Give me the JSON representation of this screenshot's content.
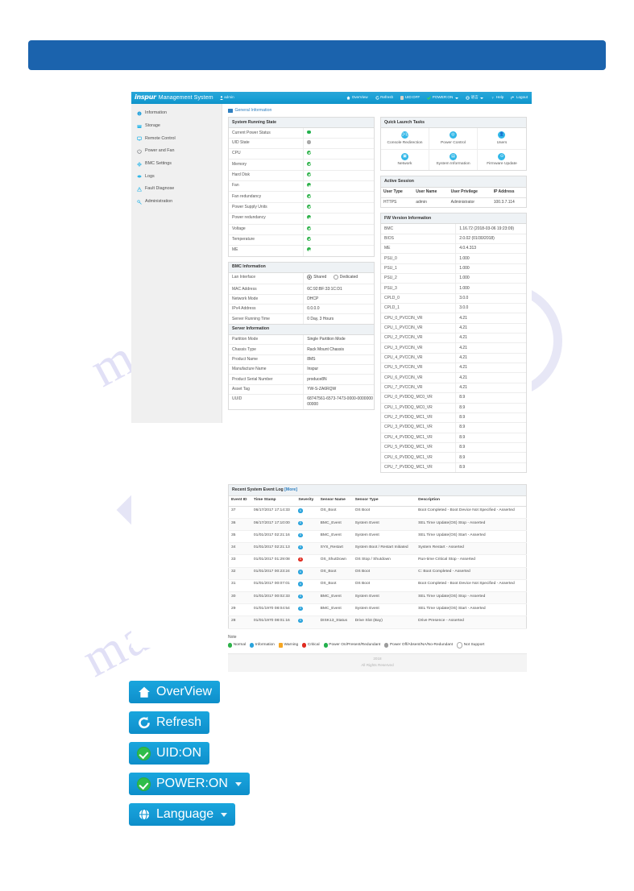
{
  "banner": {
    "text": ""
  },
  "watermark": {
    "line1": "manualslib",
    "line2": "com",
    "line3": "manualslib"
  },
  "app": {
    "brand_logo": "inspur",
    "brand_title": "Management System",
    "user": "admin",
    "topnav": [
      {
        "label": "OverView",
        "icon": "home-icon",
        "caret": false
      },
      {
        "label": "Refresh",
        "icon": "refresh-icon",
        "caret": false
      },
      {
        "label": "UID:OFF",
        "icon": "uid-led-icon",
        "caret": false
      },
      {
        "label": "POWER:ON",
        "icon": "power-check-icon",
        "caret": true
      },
      {
        "label": "语言",
        "icon": "globe-icon",
        "caret": true
      },
      {
        "label": "Help",
        "icon": "help-icon",
        "caret": false
      },
      {
        "label": "Logout",
        "icon": "logout-icon",
        "caret": false
      }
    ],
    "sidebar": [
      {
        "label": "Information",
        "icon": "info-icon"
      },
      {
        "label": "Storage",
        "icon": "storage-icon"
      },
      {
        "label": "Remote Control",
        "icon": "monitor-icon"
      },
      {
        "label": "Power and Fan",
        "icon": "power-icon"
      },
      {
        "label": "BMC Settings",
        "icon": "gear-icon"
      },
      {
        "label": "Logs",
        "icon": "logs-icon"
      },
      {
        "label": "Fault Diagnose",
        "icon": "warning-icon"
      },
      {
        "label": "Administration",
        "icon": "wrench-icon"
      }
    ],
    "breadcrumb": "General Information",
    "system_running_state": {
      "title": "System Running State",
      "rows": [
        {
          "label": "Current Power Status",
          "state": "green-dot"
        },
        {
          "label": "UID State",
          "state": "gray-dot"
        },
        {
          "label": "CPU",
          "state": "check"
        },
        {
          "label": "Memory",
          "state": "check"
        },
        {
          "label": "Hard Disk",
          "state": "check"
        },
        {
          "label": "Fan",
          "state": "check"
        },
        {
          "label": "Fan redundancy",
          "state": "check"
        },
        {
          "label": "Power Supply Units",
          "state": "check"
        },
        {
          "label": "Power redundancy",
          "state": "check"
        },
        {
          "label": "Voltage",
          "state": "check"
        },
        {
          "label": "Temperature",
          "state": "check"
        },
        {
          "label": "ME",
          "state": "check"
        }
      ]
    },
    "bmc_information": {
      "title": "BMC Information",
      "lan_interface_label": "Lan Interface",
      "lan_options": [
        {
          "label": "Shared",
          "selected": true
        },
        {
          "label": "Dedicated",
          "selected": false
        }
      ],
      "rows": [
        {
          "k": "MAC Address",
          "v": "6C:92:BF:33:1C:D1"
        },
        {
          "k": "Network Mode",
          "v": "DHCP"
        },
        {
          "k": "IPv4 Address",
          "v": "0.0.0.0"
        },
        {
          "k": "Server Running Time",
          "v": "0 Day, 3 Hours"
        }
      ]
    },
    "server_information": {
      "title": "Server Information",
      "rows": [
        {
          "k": "Partition Mode",
          "v": "Single Partition Mode"
        },
        {
          "k": "Chassis Type",
          "v": "Rack Mount Chassis"
        },
        {
          "k": "Product Name",
          "v": "8MS"
        },
        {
          "k": "Manufacture Name",
          "v": "Inspur"
        },
        {
          "k": "Product Serial Number",
          "v": "produce8N"
        },
        {
          "k": "Asset Tag",
          "v": "YW-S-ZA6RQW"
        },
        {
          "k": "UUID",
          "v": "68747561-6573-7473-0000-000000000000"
        }
      ]
    },
    "quick_launch": {
      "title": "Quick Launch Tasks",
      "items": [
        {
          "label": "Console Redirection",
          "icon": "console-icon"
        },
        {
          "label": "Power Control",
          "icon": "power-control-icon"
        },
        {
          "label": "Users",
          "icon": "user-icon"
        },
        {
          "label": "Network",
          "icon": "network-icon"
        },
        {
          "label": "System Information",
          "icon": "system-info-icon"
        },
        {
          "label": "Firmware Update",
          "icon": "firmware-icon"
        }
      ]
    },
    "active_session": {
      "title": "Active Session",
      "headers": [
        "User Type",
        "User Name",
        "User Privilege",
        "IP Address"
      ],
      "rows": [
        [
          "HTTPS",
          "admin",
          "Administrator",
          "100.3.7.114"
        ]
      ]
    },
    "fw_version": {
      "title": "FW Version Information",
      "rows": [
        {
          "k": "BMC",
          "v": "1.16.72 (2018-03-06 19:23:09)"
        },
        {
          "k": "BIOS",
          "v": "2.0.02 (01/30/2018)"
        },
        {
          "k": "ME",
          "v": "4.0.4.313"
        },
        {
          "k": "PSU_0",
          "v": "1.000"
        },
        {
          "k": "PSU_1",
          "v": "1.000"
        },
        {
          "k": "PSU_2",
          "v": "1.000"
        },
        {
          "k": "PSU_3",
          "v": "1.000"
        },
        {
          "k": "CPLD_0",
          "v": "3.0.0"
        },
        {
          "k": "CPLD_1",
          "v": "3.0.0"
        },
        {
          "k": "CPU_0_PVCCIN_VR",
          "v": "4.21"
        },
        {
          "k": "CPU_1_PVCCIN_VR",
          "v": "4.21"
        },
        {
          "k": "CPU_2_PVCCIN_VR",
          "v": "4.21"
        },
        {
          "k": "CPU_3_PVCCIN_VR",
          "v": "4.21"
        },
        {
          "k": "CPU_4_PVCCIN_VR",
          "v": "4.21"
        },
        {
          "k": "CPU_5_PVCCIN_VR",
          "v": "4.21"
        },
        {
          "k": "CPU_6_PVCCIN_VR",
          "v": "4.21"
        },
        {
          "k": "CPU_7_PVCCIN_VR",
          "v": "4.21"
        },
        {
          "k": "CPU_0_PVDDQ_MC0_VR",
          "v": "8.9"
        },
        {
          "k": "CPU_1_PVDDQ_MC0_VR",
          "v": "8.9"
        },
        {
          "k": "CPU_2_PVDDQ_MC1_VR",
          "v": "8.9"
        },
        {
          "k": "CPU_3_PVDDQ_MC1_VR",
          "v": "8.9"
        },
        {
          "k": "CPU_4_PVDDQ_MC1_VR",
          "v": "8.9"
        },
        {
          "k": "CPU_5_PVDDQ_MC1_VR",
          "v": "8.9"
        },
        {
          "k": "CPU_6_PVDDQ_MC1_VR",
          "v": "8.9"
        },
        {
          "k": "CPU_7_PVDDQ_MC1_VR",
          "v": "8.9"
        }
      ]
    },
    "sel": {
      "title": "Recent System Event Log",
      "more_label": "[More]",
      "headers": [
        "Event ID",
        "Time Stamp",
        "Severity",
        "Sensor Name",
        "Sensor Type",
        "Description"
      ],
      "rows": [
        {
          "id": "37",
          "ts": "06/17/2017 17:14:33",
          "sev": "info",
          "sensor": "OS_Boot",
          "type": "OS Boot",
          "desc": "Boot Completed - Boot Device Not Specified - Asserted"
        },
        {
          "id": "36",
          "ts": "06/17/2017 17:10:00",
          "sev": "info",
          "sensor": "BMC_Event",
          "type": "System Event",
          "desc": "SEL Time Update(OS) Stop - Asserted"
        },
        {
          "id": "35",
          "ts": "01/01/2017 02:21:16",
          "sev": "info",
          "sensor": "BMC_Event",
          "type": "System Event",
          "desc": "SEL Time Update(OS) Start - Asserted"
        },
        {
          "id": "34",
          "ts": "01/01/2017 02:21:13",
          "sev": "info",
          "sensor": "SYS_Restart",
          "type": "System Boot / Restart Initiated",
          "desc": "System Restart - Asserted"
        },
        {
          "id": "33",
          "ts": "01/01/2017 01:29:08",
          "sev": "critical",
          "sensor": "OS_ShutDown",
          "type": "OS Stop / Shutdown",
          "desc": "Run-time Critical Stop - Asserted"
        },
        {
          "id": "32",
          "ts": "01/01/2017 00:23:24",
          "sev": "info",
          "sensor": "OS_Boot",
          "type": "OS Boot",
          "desc": "C: Boot Completed - Asserted"
        },
        {
          "id": "31",
          "ts": "01/01/2017 00:07:01",
          "sev": "info",
          "sensor": "OS_Boot",
          "type": "OS Boot",
          "desc": "Boot Completed - Boot Device Not Specified - Asserted"
        },
        {
          "id": "30",
          "ts": "01/01/2017 00:02:33",
          "sev": "info",
          "sensor": "BMC_Event",
          "type": "System Event",
          "desc": "SEL Time Update(OS) Stop - Asserted"
        },
        {
          "id": "29",
          "ts": "01/01/1970 08:04:54",
          "sev": "info",
          "sensor": "BMC_Event",
          "type": "System Event",
          "desc": "SEL Time Update(OS) Start - Asserted"
        },
        {
          "id": "28",
          "ts": "01/01/1970 08:01:16",
          "sev": "info",
          "sensor": "DISK13_Status",
          "type": "Drive Slot (Bay)",
          "desc": "Drive Presence - Asserted"
        }
      ]
    },
    "note": {
      "title": "Note",
      "legend": [
        {
          "label": "Normal",
          "kind": "normal"
        },
        {
          "label": "Information",
          "kind": "info"
        },
        {
          "label": "Warning",
          "kind": "warn"
        },
        {
          "label": "Critical",
          "kind": "crit"
        },
        {
          "label": "Power On/Present/Redundant",
          "kind": "on"
        },
        {
          "label": "Power Off/Absent/NA/No-Redundant",
          "kind": "off"
        },
        {
          "label": "Not Support",
          "kind": "ns"
        }
      ]
    },
    "footer": {
      "line1": "2018",
      "line2": "All Rights Reserved"
    }
  },
  "callouts": [
    {
      "label": "OverView",
      "icon": "home-icon",
      "style": "plain",
      "caret": false
    },
    {
      "label": "Refresh",
      "icon": "refresh-icon",
      "style": "plain",
      "caret": false
    },
    {
      "label": "UID:ON",
      "icon": "green-check-icon",
      "style": "check",
      "caret": false
    },
    {
      "label": "POWER:ON",
      "icon": "green-check-icon",
      "style": "check",
      "caret": true
    },
    {
      "label": "Language",
      "icon": "globe-icon",
      "style": "plain",
      "caret": true
    }
  ],
  "colors": {
    "banner_blue": "#1b63ad",
    "app_cyan": "#19a6dd",
    "status_green": "#2eb24a",
    "status_info": "#29a3dc",
    "status_critical": "#e02b20",
    "status_warning": "#f5a623",
    "link_blue": "#2f7fc0"
  }
}
